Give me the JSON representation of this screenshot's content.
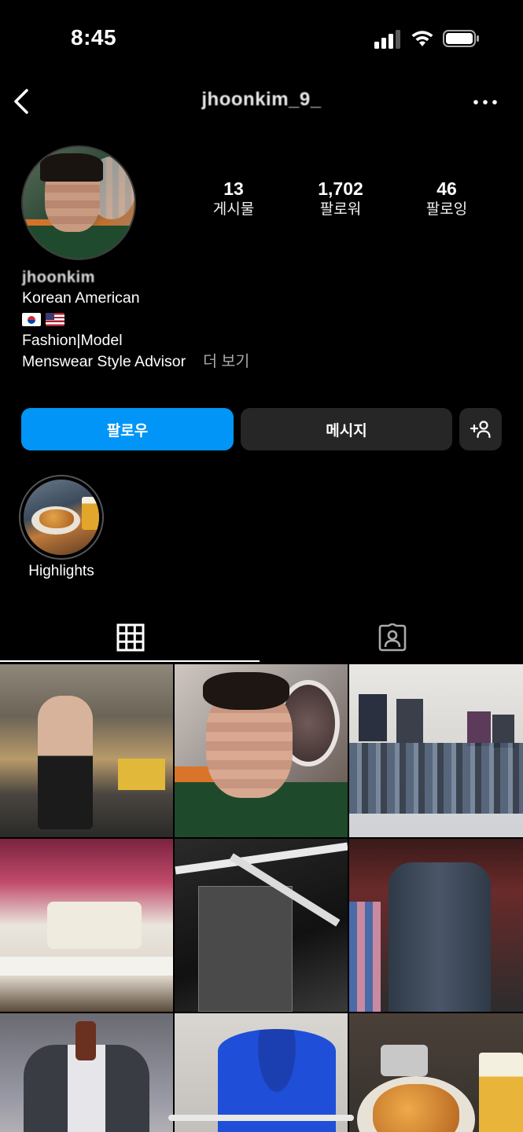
{
  "status_bar": {
    "time": "8:45"
  },
  "header": {
    "username": "jhoonkim_9_"
  },
  "profile": {
    "display_name": "jhoonkim",
    "stats": [
      {
        "value": "13",
        "label": "게시물"
      },
      {
        "value": "1,702",
        "label": "팔로워"
      },
      {
        "value": "46",
        "label": "팔로잉"
      }
    ],
    "bio": {
      "line1": "Korean American",
      "line2": "Fashion|Model",
      "line3": "Menswear Style Advisor",
      "more": "더 보기"
    }
  },
  "actions": {
    "follow": "팔로우",
    "message": "메시지"
  },
  "highlights": [
    {
      "label": "Highlights"
    }
  ],
  "colors": {
    "accent": "#0095f6",
    "background": "#000000",
    "button_dark": "#262626"
  }
}
